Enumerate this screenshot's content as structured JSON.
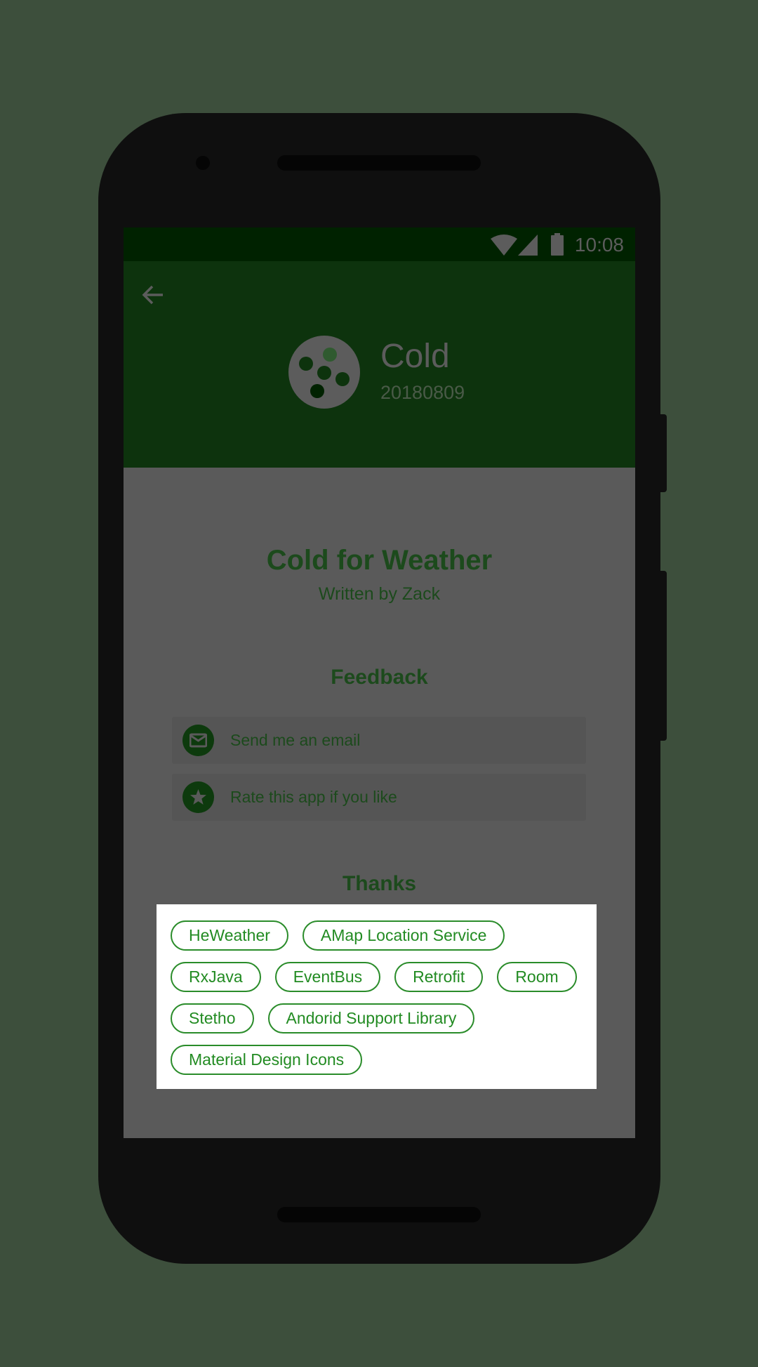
{
  "status_bar": {
    "time": "10:08",
    "icons": [
      "wifi-icon",
      "signal-icon",
      "battery-icon"
    ]
  },
  "header": {
    "back_icon": "arrow-left-icon",
    "app_name": "Cold",
    "version": "20180809"
  },
  "about": {
    "title": "Cold for Weather",
    "subtitle": "Written by Zack"
  },
  "feedback": {
    "heading": "Feedback",
    "items": [
      {
        "label": "Send me an email",
        "icon": "email-icon"
      },
      {
        "label": "Rate this app if you like",
        "icon": "star-icon"
      }
    ]
  },
  "thanks": {
    "heading": "Thanks",
    "chips": [
      [
        "HeWeather",
        "AMap Location Service"
      ],
      [
        "RxJava",
        "EventBus",
        "Retrofit",
        "Room"
      ],
      [
        "Stetho",
        "Andorid Support Library"
      ],
      [
        "Material Design Icons"
      ]
    ]
  },
  "colors": {
    "primary": "#0d330d",
    "status_bar": "#002200",
    "chip": "#228b22",
    "background": "#3d4f3c"
  }
}
